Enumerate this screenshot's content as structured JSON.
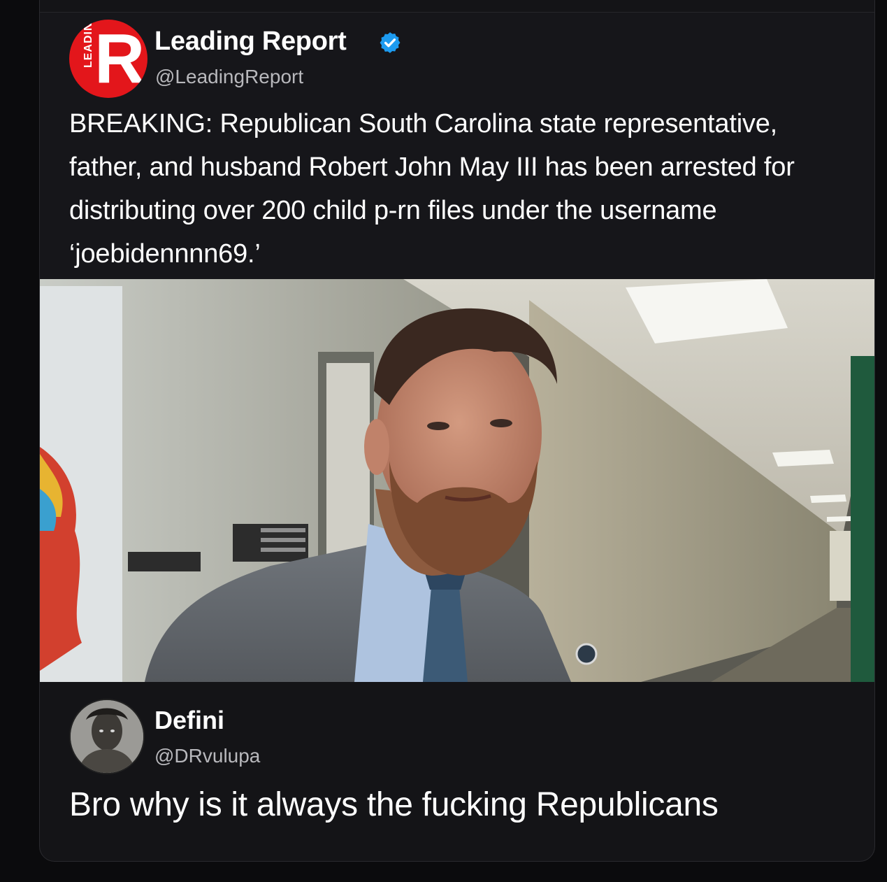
{
  "quoted_tweet": {
    "account_name": "Leading Report",
    "handle": "@LeadingReport",
    "verified": true,
    "logo": {
      "letter": "R",
      "side_text": "LEADING",
      "color": "#e3161b"
    },
    "text": "BREAKING: Republican South Carolina state representative, father, and husband Robert John May III has been arrested for distributing over 200 child p-rn files under the username ‘joebidennnn69.’",
    "photo_icon": "news-photo"
  },
  "reply": {
    "account_name": "Defini",
    "handle": "@DRvulupa",
    "text": "Bro why is it always the fucking Republicans",
    "avatar_icon": "user-avatar"
  },
  "colors": {
    "background": "#0b0b0d",
    "card": "#141417",
    "verified_badge": "#1d9bf0",
    "secondary_text": "#b8b8bc"
  }
}
